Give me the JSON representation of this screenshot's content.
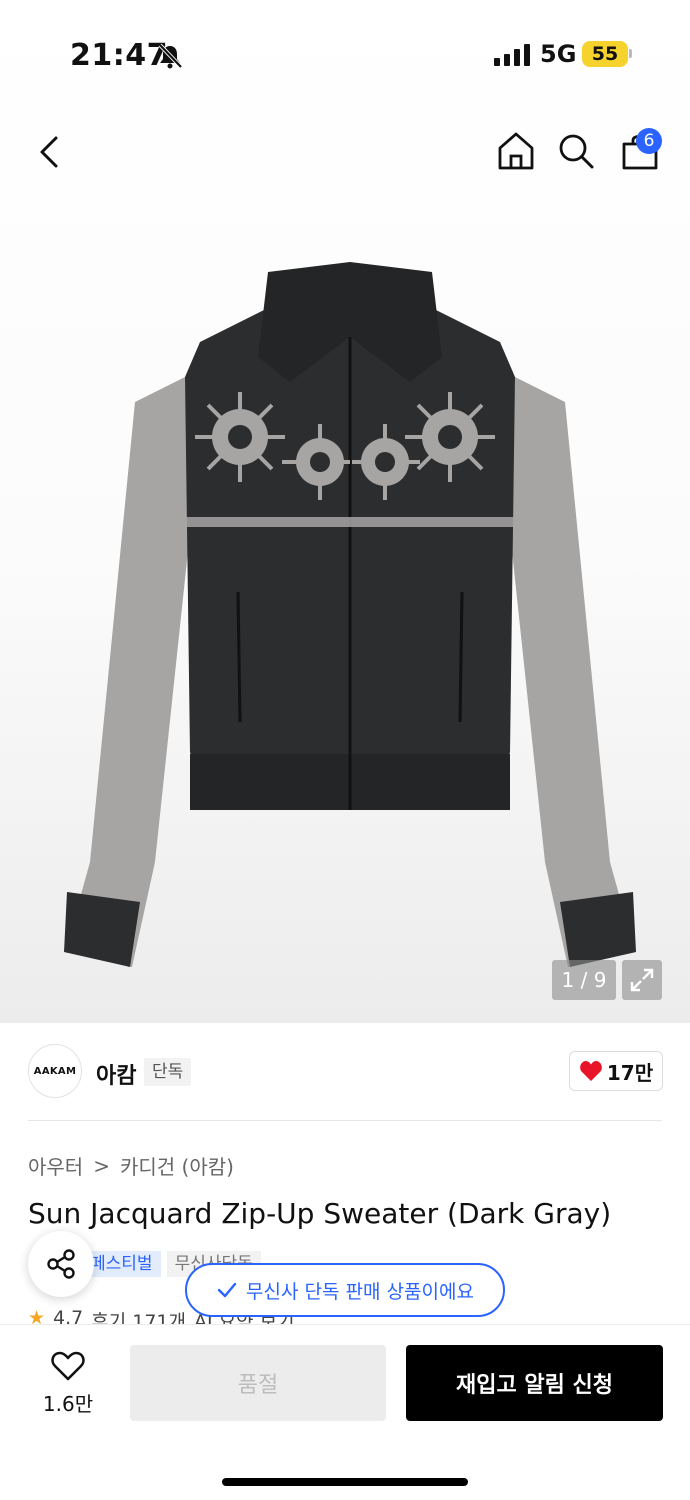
{
  "status_bar": {
    "time": "21:47",
    "network": "5G",
    "battery": "55"
  },
  "nav": {
    "bag_count": "6"
  },
  "gallery": {
    "counter": "1 / 9"
  },
  "brand": {
    "logo_text": "AAKAM",
    "name": "아캄",
    "tag": "단독",
    "likes": "17만"
  },
  "breadcrumb": {
    "items": [
      "아우터",
      "카디건 (아캄)"
    ],
    "separator": ">"
  },
  "product": {
    "title": "Sun Jacquard Zip-Up Sweater (Dark Gray)",
    "tags": [
      "페스티벌",
      "무신사단독"
    ]
  },
  "toast": {
    "message": "무신사 단독 판매 상품이에요"
  },
  "rating": {
    "score": "4.7",
    "reviews": "후기 171개",
    "ai_summary": "AI 요약 보기"
  },
  "bottom": {
    "wish_count": "1.6만",
    "soldout_label": "품절",
    "restock_label": "재입고 알림 신청"
  },
  "colors": {
    "accent_blue": "#2a63ff",
    "heart_red": "#e8142a",
    "battery_yellow": "#f5d22c",
    "sweater_body": "#2b2d2e",
    "sweater_pattern": "#a7a5a4"
  },
  "icons": [
    "back-icon",
    "home-icon",
    "search-icon",
    "bag-icon",
    "expand-icon",
    "heart-icon",
    "share-icon",
    "check-icon",
    "star-icon",
    "bell-muted-icon"
  ]
}
